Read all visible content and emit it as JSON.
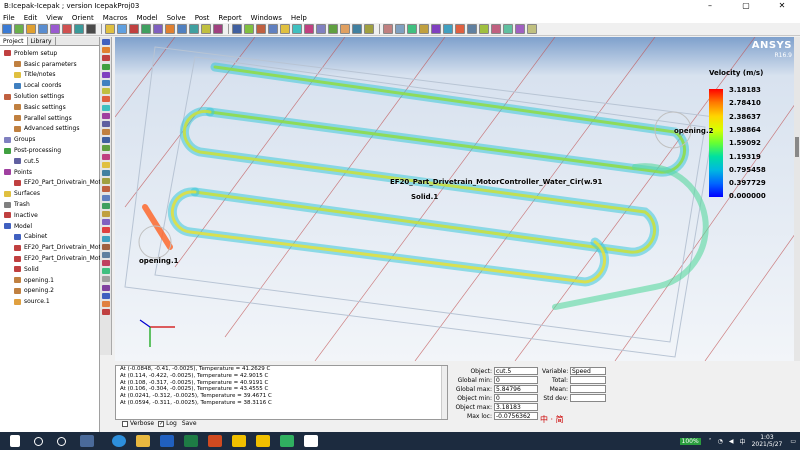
{
  "window": {
    "title": "B:Icepak-Icepak ; version IcepakProj03",
    "minimize": "–",
    "restore": "▢",
    "close": "✕"
  },
  "menu": [
    "File",
    "Edit",
    "View",
    "Orient",
    "Macros",
    "Model",
    "Solve",
    "Post",
    "Report",
    "Windows",
    "Help"
  ],
  "tabs": [
    "Project",
    "Library"
  ],
  "tree": [
    {
      "label": "Problem setup",
      "level": 0,
      "color": "#c04040"
    },
    {
      "label": "Basic parameters",
      "level": 1,
      "color": "#c08040"
    },
    {
      "label": "Title/notes",
      "level": 1,
      "color": "#e0c040"
    },
    {
      "label": "Local coords",
      "level": 1,
      "color": "#4080c0"
    },
    {
      "label": "Solution settings",
      "level": 0,
      "color": "#c06040"
    },
    {
      "label": "Basic settings",
      "level": 1,
      "color": "#c08040"
    },
    {
      "label": "Parallel settings",
      "level": 1,
      "color": "#c08040"
    },
    {
      "label": "Advanced settings",
      "level": 1,
      "color": "#c08040"
    },
    {
      "label": "Groups",
      "level": 0,
      "color": "#8080c0"
    },
    {
      "label": "Post-processing",
      "level": 0,
      "color": "#40a040"
    },
    {
      "label": "cut.5",
      "level": 1,
      "color": "#6060a0"
    },
    {
      "label": "Points",
      "level": 0,
      "color": "#a040a0"
    },
    {
      "label": "EF20_Part_Drivetrain_Motor",
      "level": 1,
      "color": "#c04040"
    },
    {
      "label": "Surfaces",
      "level": 0,
      "color": "#e0c040"
    },
    {
      "label": "Trash",
      "level": 0,
      "color": "#808080"
    },
    {
      "label": "Inactive",
      "level": 0,
      "color": "#c04040"
    },
    {
      "label": "Model",
      "level": 0,
      "color": "#4060c0"
    },
    {
      "label": "Cabinet",
      "level": 1,
      "color": "#4060c0"
    },
    {
      "label": "EF20_Part_Drivetrain_Motor",
      "level": 1,
      "color": "#c04040"
    },
    {
      "label": "EF20_Part_Drivetrain_Motor",
      "level": 1,
      "color": "#c04040"
    },
    {
      "label": "Solid",
      "level": 1,
      "color": "#c04040"
    },
    {
      "label": "opening.1",
      "level": 1,
      "color": "#c08040"
    },
    {
      "label": "opening.2",
      "level": 1,
      "color": "#c08040"
    },
    {
      "label": "source.1",
      "level": 1,
      "color": "#e0a040"
    }
  ],
  "viewport": {
    "brand": "ANSYS",
    "version": "R16.9",
    "model_label": "EF20_Part_Drivetrain_MotorController_Water_Cir(w.91",
    "solid_label": "Solid.1",
    "opening1_label": "opening.1",
    "opening2_label": "opening.2"
  },
  "legend": {
    "title": "Velocity (m/s)",
    "values": [
      "3.18183",
      "2.78410",
      "2.38637",
      "1.98864",
      "1.59092",
      "1.19319",
      "0.795458",
      "0.397729",
      "0.000000"
    ]
  },
  "messages": [
    "At (-0.0848, -0.41, -0.0025), Temperature = 41.2629 C",
    "At (0.114, -0.422, -0.0025), Temperature = 42.9015 C",
    "At (0.108, -0.317, -0.0025), Temperature = 40.9191 C",
    "At (0.106, -0.304, -0.0025), Temperature = 43.4555 C",
    "At (0.0241, -0.312, -0.0025), Temperature = 39.4671 C",
    "At (0.0594, -0.311, -0.0025), Temperature = 38.3116 C"
  ],
  "log_controls": {
    "verbose": "Verbose",
    "log": "Log",
    "save": "Save"
  },
  "stats": {
    "object_label": "Object:",
    "object": "cut.5",
    "variable_label": "Variable:",
    "variable": "Speed",
    "global_min_label": "Global min:",
    "global_min": "0",
    "global_max_label": "Global max:",
    "global_max": "5.84796",
    "object_min_label": "Object min:",
    "object_min": "0",
    "object_max_label": "Object max:",
    "object_max": "3.18183",
    "max_loc_label": "Max loc:",
    "max_loc": "-0.0756362",
    "total_label": "Total:",
    "mean_label": "Mean:",
    "std_label": "Std dev:"
  },
  "ime": "中 · 简",
  "taskbar": {
    "battery": "100%",
    "lang": "中",
    "time": "1:03",
    "date": "2021/5/27"
  }
}
